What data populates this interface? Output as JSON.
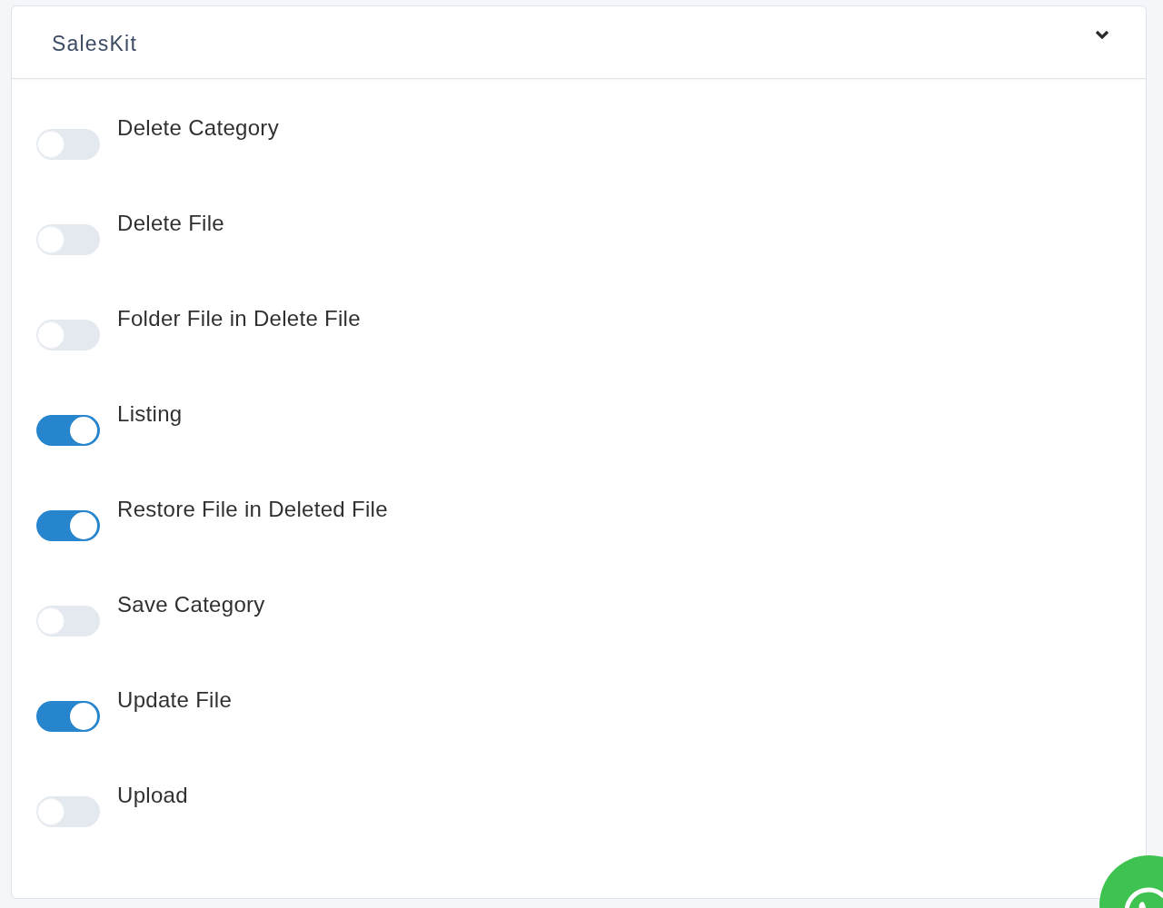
{
  "panel": {
    "title": "SalesKit",
    "expanded": true,
    "permissions": [
      {
        "label": "Delete Category",
        "on": false
      },
      {
        "label": "Delete File",
        "on": false
      },
      {
        "label": "Folder File in Delete File",
        "on": false
      },
      {
        "label": "Listing",
        "on": true
      },
      {
        "label": "Restore File in Deleted File",
        "on": true
      },
      {
        "label": "Save Category",
        "on": false
      },
      {
        "label": "Update File",
        "on": true
      },
      {
        "label": "Upload",
        "on": false
      }
    ]
  }
}
